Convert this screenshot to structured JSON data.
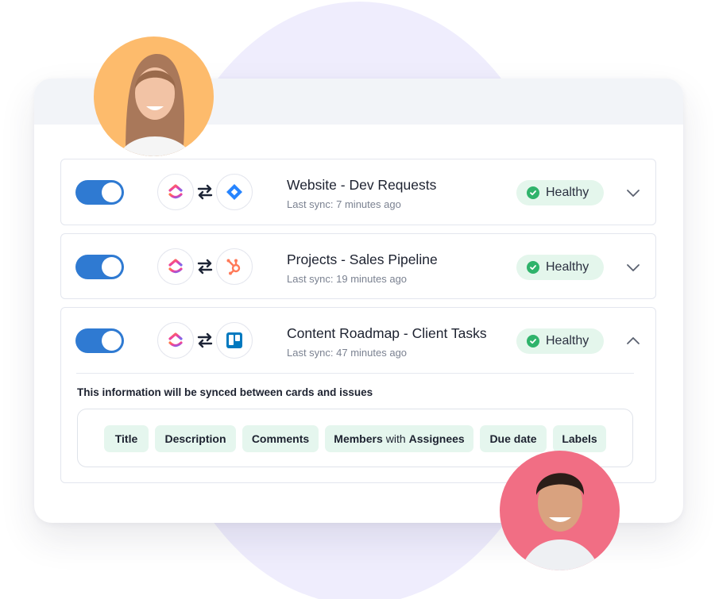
{
  "colors": {
    "accent": "#2f7ad2",
    "healthy_bg": "#e4f6ec",
    "healthy_icon": "#2fb36b",
    "chip_bg": "#e5f6ee",
    "backdrop": "#efedfd",
    "avatar_woman_bg": "#fdbb6c",
    "avatar_man_bg": "#f16e84"
  },
  "integrations": [
    {
      "enabled": true,
      "source_icon": "clickup-icon",
      "target_icon": "jira-icon",
      "title": "Website - Dev Requests",
      "last_sync": "Last sync: 7 minutes ago",
      "status": "Healthy",
      "expanded": false
    },
    {
      "enabled": true,
      "source_icon": "clickup-icon",
      "target_icon": "hubspot-icon",
      "title": "Projects - Sales Pipeline",
      "last_sync": "Last sync: 19 minutes ago",
      "status": "Healthy",
      "expanded": false
    },
    {
      "enabled": true,
      "source_icon": "clickup-icon",
      "target_icon": "trello-icon",
      "title": "Content Roadmap - Client Tasks",
      "last_sync": "Last sync: 47 minutes ago",
      "status": "Healthy",
      "expanded": true,
      "details": {
        "note": "This information will be synced between cards and issues",
        "fields": [
          {
            "label": "Title"
          },
          {
            "label": "Description"
          },
          {
            "label": "Comments"
          },
          {
            "label_a": "Members",
            "connector": "with",
            "label_b": "Assignees"
          },
          {
            "label": "Due date"
          },
          {
            "label": "Labels"
          }
        ]
      }
    }
  ],
  "avatars": [
    {
      "name": "avatar-woman"
    },
    {
      "name": "avatar-man"
    }
  ]
}
